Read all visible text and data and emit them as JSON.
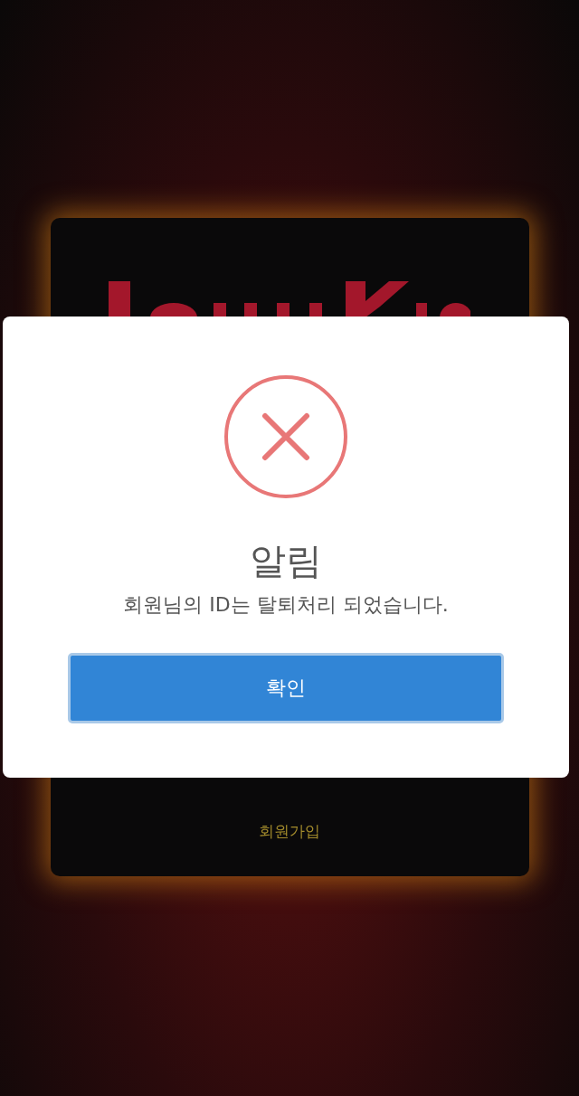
{
  "login_card": {
    "signup_link": "회원가입"
  },
  "alert": {
    "title": "알림",
    "message": "회원님의 ID는 탈퇴처리 되었습니다.",
    "confirm_button": "확인"
  }
}
